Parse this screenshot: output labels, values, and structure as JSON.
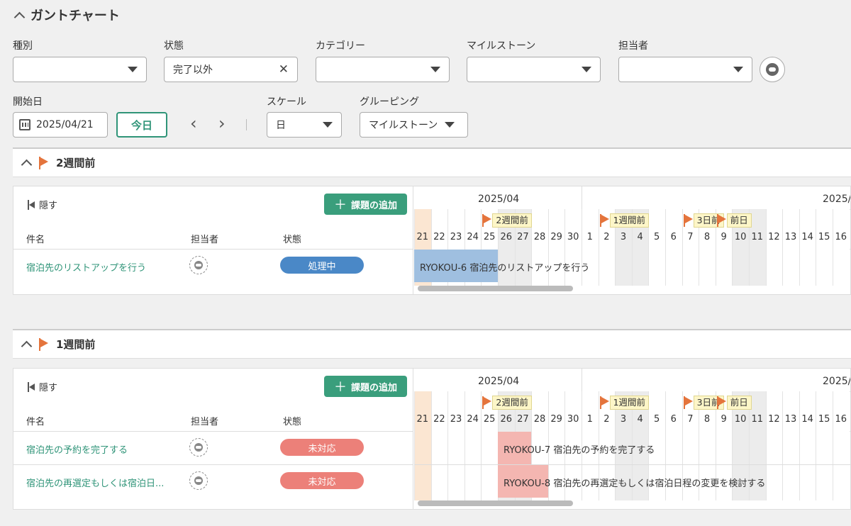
{
  "title": "ガントチャート",
  "filters": {
    "type_label": "種別",
    "type_value": "",
    "status_label": "状態",
    "status_value": "完了以外",
    "category_label": "カテゴリー",
    "category_value": "",
    "milestone_label": "マイルストーン",
    "milestone_value": "",
    "assignee_label": "担当者",
    "assignee_value": "",
    "start_label": "開始日",
    "start_value": "2025/04/21",
    "today_label": "今日",
    "scale_label": "スケール",
    "scale_value": "日",
    "grouping_label": "グルーピング",
    "grouping_value": "マイルストーン"
  },
  "columns": {
    "hide": "隠す",
    "add": "課題の追加",
    "name": "件名",
    "assignee": "担当者",
    "status": "状態"
  },
  "timeline": {
    "months": [
      "2025/04",
      "2025/"
    ],
    "days": [
      "21",
      "22",
      "23",
      "24",
      "25",
      "26",
      "27",
      "28",
      "29",
      "30",
      "1",
      "2",
      "3",
      "4",
      "5",
      "6",
      "7",
      "8",
      "9",
      "10",
      "11",
      "12",
      "13",
      "14",
      "15",
      "16"
    ],
    "milestones": [
      "2週間前",
      "1週間前",
      "3日前",
      "前日"
    ]
  },
  "groups": [
    {
      "name": "2週間前",
      "tasks": [
        {
          "name": "宿泊先のリストアップを行う",
          "status": "処理中",
          "status_color": "#4a88c7",
          "key": "RYOKOU-6",
          "bar_text": "宿泊先のリストアップを行う",
          "bar_color": "#9fbfe0"
        }
      ]
    },
    {
      "name": "1週間前",
      "tasks": [
        {
          "name": "宿泊先の予約を完了する",
          "status": "未対応",
          "status_color": "#ec8079",
          "key": "RYOKOU-7",
          "bar_text": "宿泊先の予約を完了する",
          "bar_color": "#f4b6b1"
        },
        {
          "name": "宿泊先の再選定もしくは宿泊日...",
          "status": "未対応",
          "status_color": "#ec8079",
          "key": "RYOKOU-8",
          "bar_text": "宿泊先の再選定もしくは宿泊日程の変更を検討する",
          "bar_color": "#f4b6b1"
        }
      ]
    }
  ]
}
